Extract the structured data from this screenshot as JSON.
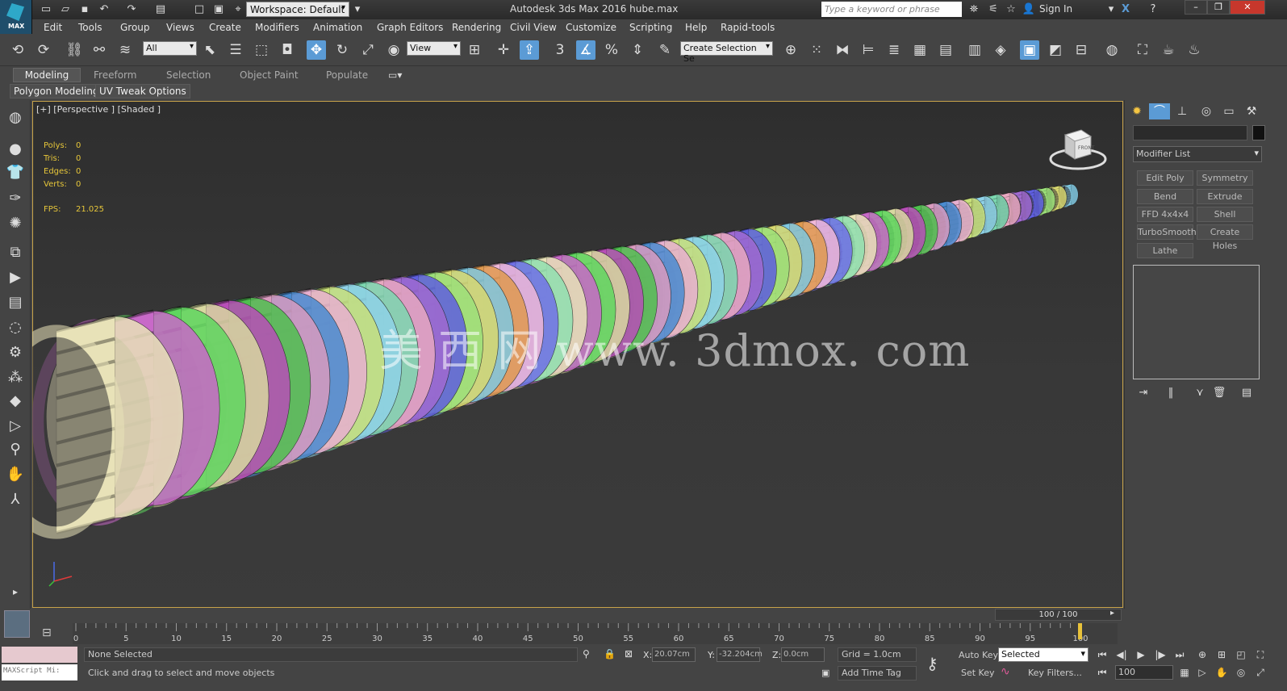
{
  "titlebar": {
    "workspace": "Workspace: Default",
    "title": "Autodesk 3ds Max 2016      hube.max",
    "search_placeholder": "Type a keyword or phrase",
    "sign_in": "Sign In",
    "logo_text": "MAX"
  },
  "menu": [
    "Edit",
    "Tools",
    "Group",
    "Views",
    "Create",
    "Modifiers",
    "Animation",
    "Graph Editors",
    "Rendering",
    "Civil View",
    "Customize",
    "Scripting",
    "Help",
    "Rapid-tools"
  ],
  "toolbar": {
    "filter_value": "All",
    "refcoord_value": "View",
    "selection_set_value": "Create Selection Se",
    "snap_label": "3"
  },
  "ribbon": {
    "tabs": [
      "Modeling",
      "Freeform",
      "Selection",
      "Object Paint",
      "Populate"
    ],
    "subtabs": [
      "Polygon Modeling",
      "UV Tweak Options"
    ]
  },
  "viewport": {
    "label": "[+] [Perspective ] [Shaded ]",
    "stats": [
      {
        "name": "Polys:",
        "value": "0"
      },
      {
        "name": "Tris:",
        "value": "0"
      },
      {
        "name": "Edges:",
        "value": "0"
      },
      {
        "name": "Verts:",
        "value": "0"
      }
    ],
    "fps_label": "FPS:",
    "fps_value": "21.025",
    "watermark": "美 西 网 www. 3dmox. com",
    "viewcube_label": "FRONT",
    "gear_colors": [
      "#e8e2b8",
      "#c869c8",
      "#5fd65f",
      "#d8d8a0",
      "#b84fb8",
      "#4fbf4f",
      "#d99bbf",
      "#4a8bd0",
      "#e8b0d0",
      "#c9e07a",
      "#8fd2e8",
      "#7cd7b0",
      "#e8a8c0",
      "#a06ad0",
      "#5f5fe0",
      "#9ce07a",
      "#d8d870",
      "#80c8e0",
      "#e09a50",
      "#f0b8d8",
      "#7070e8",
      "#90e0b0"
    ]
  },
  "command_panel": {
    "modifier_list": "Modifier List",
    "modifier_buttons": [
      "Edit Poly",
      "Symmetry",
      "Bend",
      "Extrude",
      "FFD 4x4x4",
      "Shell",
      "TurboSmooth",
      "Create Holes",
      "Lathe"
    ]
  },
  "timeline": {
    "slider": "100 / 100",
    "ticks": [
      "0",
      "5",
      "10",
      "15",
      "20",
      "25",
      "30",
      "35",
      "40",
      "45",
      "50",
      "55",
      "60",
      "65",
      "70",
      "75",
      "80",
      "85",
      "90",
      "95",
      "100"
    ]
  },
  "status": {
    "maxscript": "MAXScript Mi:",
    "selection": "None Selected",
    "prompt": "Click and drag to select and move objects",
    "x_label": "X:",
    "x_value": "20.07cm",
    "y_label": "Y:",
    "y_value": "-32.204cm",
    "z_label": "Z:",
    "z_value": "0.0cm",
    "grid": "Grid = 1.0cm",
    "add_time_tag": "Add Time Tag",
    "auto_key": "Auto Key",
    "set_key": "Set Key",
    "selected_dd": "Selected",
    "key_filters": "Key Filters...",
    "frame": "100"
  }
}
